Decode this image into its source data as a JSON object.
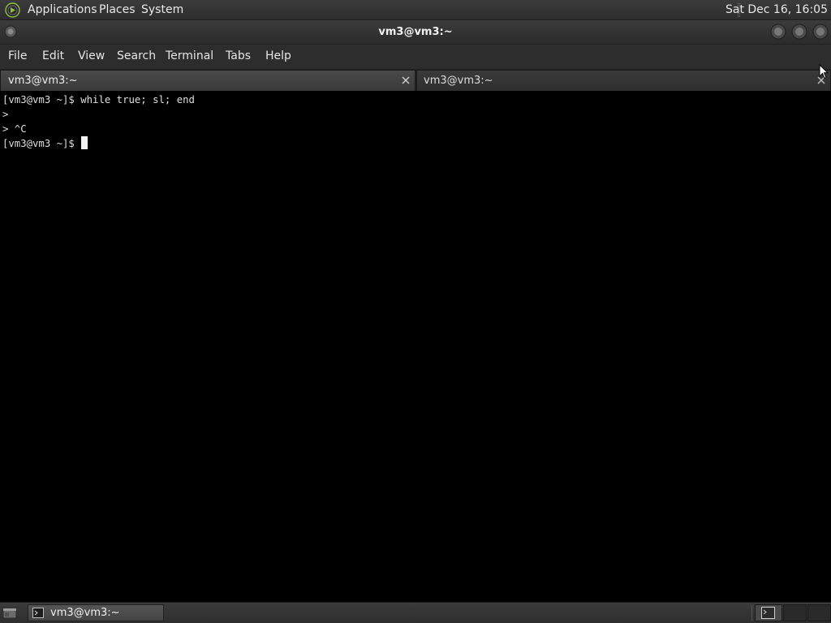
{
  "top_panel": {
    "menus": [
      "Applications",
      "Places",
      "System"
    ],
    "clock": "Sat Dec 16, 16:05",
    "icon": "distro-menu-icon"
  },
  "window": {
    "title": "vm3@vm3:~",
    "menu_bar": [
      "File",
      "Edit",
      "View",
      "Search",
      "Terminal",
      "Tabs",
      "Help"
    ],
    "tabs": [
      {
        "label": "vm3@vm3:~",
        "active": true
      },
      {
        "label": "vm3@vm3:~",
        "active": false
      }
    ]
  },
  "terminal": {
    "lines": [
      "[vm3@vm3 ~]$ while true; sl; end",
      ">",
      "> ^C"
    ],
    "prompt": "[vm3@vm3 ~]$ ",
    "background": "#000000",
    "foreground": "#dedede"
  },
  "bottom_panel": {
    "taskbar": [
      {
        "label": "vm3@vm3:~",
        "icon": "terminal-icon"
      }
    ],
    "workspaces_count": 3
  },
  "colors": {
    "panel": "#333333",
    "accent_logo": "#8fc23a"
  }
}
